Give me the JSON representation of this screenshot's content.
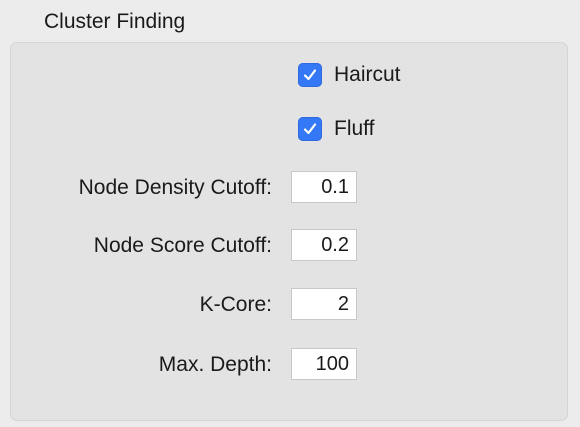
{
  "section": {
    "title": "Cluster Finding"
  },
  "checkboxes": [
    {
      "label": "Haircut",
      "checked": true,
      "icon": "checkmark-icon"
    },
    {
      "label": "Fluff",
      "checked": true,
      "icon": "checkmark-icon"
    }
  ],
  "fields": [
    {
      "label": "Node Density Cutoff:",
      "value": "0.1"
    },
    {
      "label": "Node Score Cutoff:",
      "value": "0.2"
    },
    {
      "label": "K-Core:",
      "value": "2"
    },
    {
      "label": "Max. Depth:",
      "value": "100"
    }
  ],
  "colors": {
    "checkbox_accent": "#3478f6",
    "panel_background": "#e3e3e3",
    "window_background": "#ececec"
  }
}
